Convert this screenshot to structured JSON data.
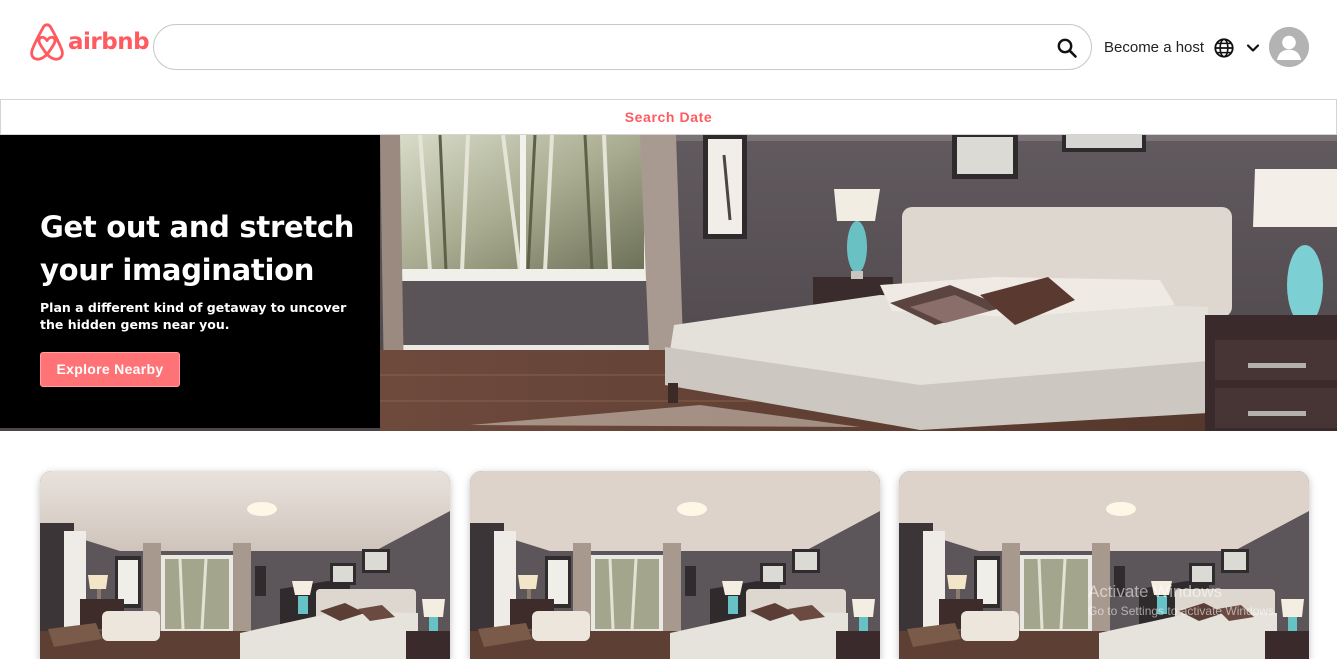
{
  "header": {
    "logo_text": "airbnb",
    "search": {
      "value": "",
      "placeholder": ""
    },
    "host_label": "Become a host"
  },
  "search_date": {
    "label": "Search Date"
  },
  "hero": {
    "title": "Get out and stretch your imagination",
    "subtitle": "Plan a different kind of getaway to uncover the hidden gems near you.",
    "button_label": "Explore Nearby"
  },
  "cards": [
    {
      "image": "bedroom-photo"
    },
    {
      "image": "bedroom-photo"
    },
    {
      "image": "bedroom-photo"
    }
  ],
  "watermark": {
    "line1": "Activate Windows",
    "line2": "Go to Settings to activate Windows."
  },
  "colors": {
    "brand": "#FF5A5F",
    "button": "#FF7376",
    "hero_panel": "#000000"
  },
  "icons": [
    "airbnb-logo-icon",
    "search-icon",
    "globe-icon",
    "chevron-down-icon",
    "user-avatar-icon"
  ]
}
